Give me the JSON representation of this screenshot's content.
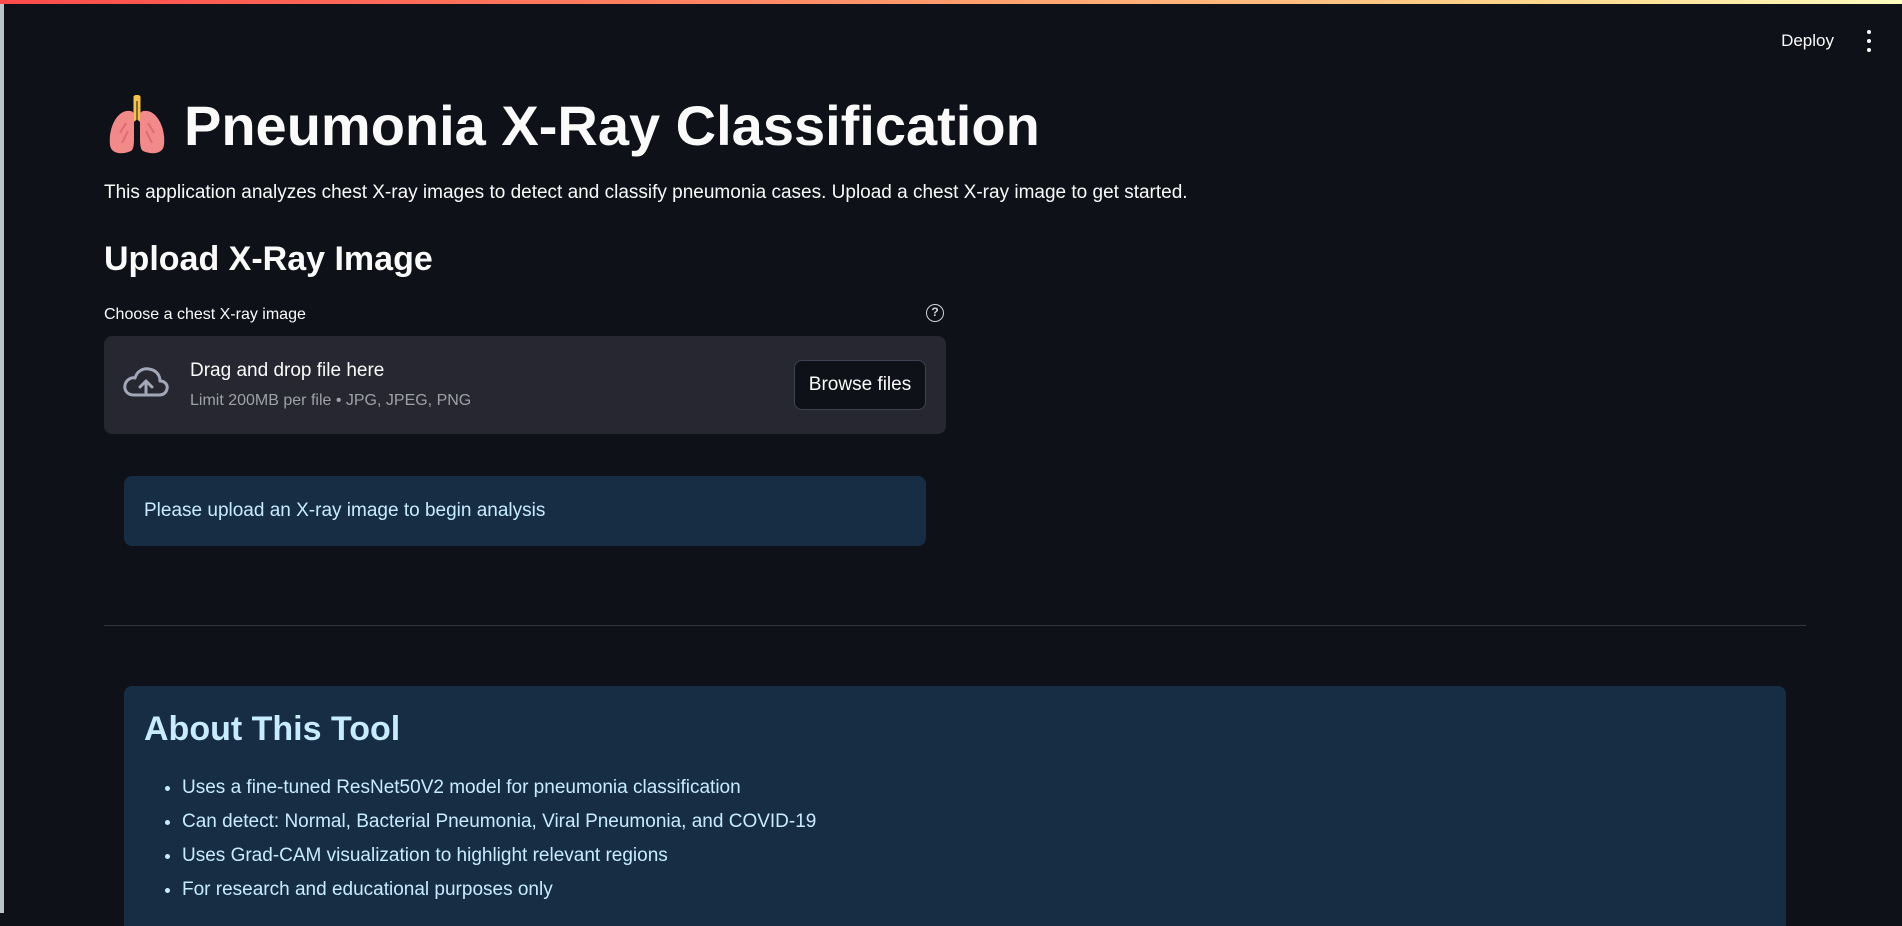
{
  "header": {
    "deploy_label": "Deploy",
    "menu_icon": "kebab-menu-icon"
  },
  "page": {
    "title_icon": "lungs-icon",
    "title": "Pneumonia X-Ray Classification",
    "intro": "This application analyzes chest X-ray images to detect and classify pneumonia cases. Upload a chest X-ray image to get started."
  },
  "upload": {
    "heading": "Upload X-Ray Image",
    "label": "Choose a chest X-ray image",
    "help_icon": "help-circle-icon",
    "dropzone_icon": "cloud-upload-icon",
    "dropzone_title": "Drag and drop file here",
    "dropzone_limit": "Limit 200MB per file • JPG, JPEG, PNG",
    "browse_label": "Browse files"
  },
  "info": {
    "message": "Please upload an X-ray image to begin analysis"
  },
  "about": {
    "title": "About This Tool",
    "items": [
      "Uses a fine-tuned ResNet50V2 model for pneumonia classification",
      "Can detect: Normal, Bacterial Pneumonia, Viral Pneumonia, and COVID-19",
      "Uses Grad-CAM visualization to highlight relevant regions",
      "For research and educational purposes only"
    ]
  },
  "colors": {
    "background": "#0e1117",
    "dropzone_bg": "#262730",
    "info_bg": "#172d43",
    "info_text": "#c7ebff",
    "accent": "#ff4b4b"
  }
}
